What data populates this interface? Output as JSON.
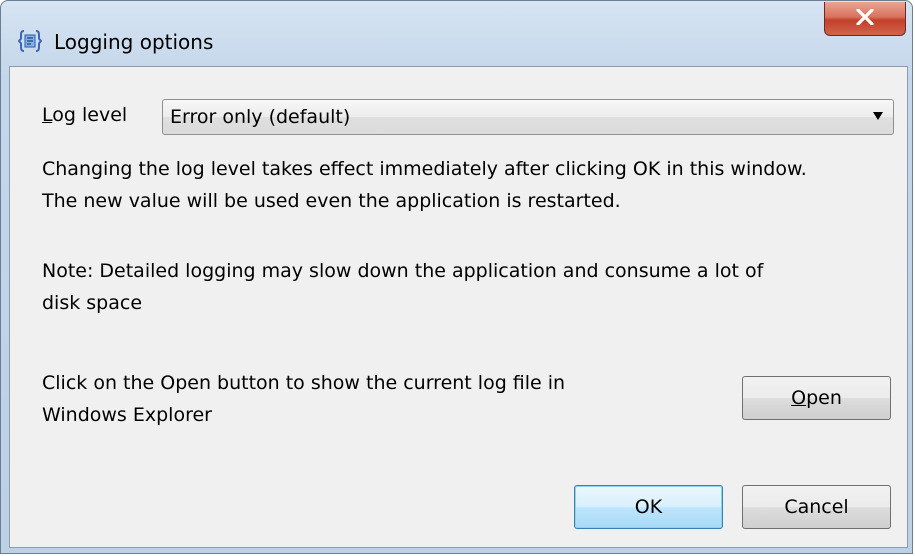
{
  "window": {
    "title": "Logging options",
    "close_label": "X"
  },
  "log_level": {
    "label_prefix": "",
    "label_underlined": "L",
    "label_rest": "og level",
    "selected_value": "Error only (default)"
  },
  "info": {
    "line1": "Changing the log level takes effect immediately after clicking OK in this window.",
    "line2": "The new value will be used even the application is restarted.",
    "note_line1": "Note: Detailed logging may slow down the application and consume a lot of",
    "note_line2": "disk space",
    "open_hint_line1": "Click on the Open button to show the current log file in",
    "open_hint_line2": "Windows Explorer"
  },
  "buttons": {
    "open_underlined": "O",
    "open_rest": "pen",
    "ok": "OK",
    "cancel": "Cancel"
  },
  "colors": {
    "title_bar": "#c4d6ea",
    "close_button": "#c2402a",
    "dialog_background": "#f0f0f0",
    "default_button_border": "#3c7fb1"
  },
  "icons": {
    "app": "logging-options-app-icon",
    "close": "close-icon",
    "dropdown": "chevron-down-icon"
  }
}
